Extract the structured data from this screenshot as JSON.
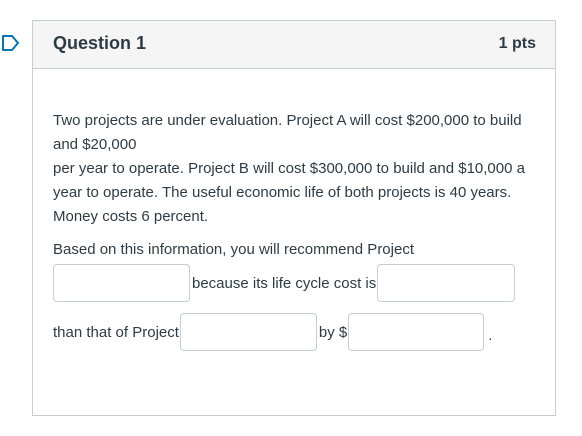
{
  "question": {
    "title": "Question 1",
    "points": "1 pts",
    "paragraph_line1": "Two projects are under evaluation. Project A will cost $200,000 to build and $20,000",
    "paragraph_line2": "per year to operate. Project B will cost $300,000 to build and $10,000 a year to operate. The useful economic life of both projects is 40 years. Money costs 6 percent.",
    "prompt": "Based on this information, you will recommend Project",
    "label_because": "because its life cycle cost is",
    "label_than": "than that of Project",
    "label_by": "by $",
    "label_period": "."
  },
  "answers": {
    "project_recommended": "",
    "comparison": "",
    "other_project": "",
    "difference": ""
  },
  "colors": {
    "header_bg": "#f5f5f5",
    "border": "#c7cdd1",
    "text": "#2d3b45",
    "flag": "#0374b5"
  },
  "icons": {
    "flag": "flag-outline-icon"
  }
}
